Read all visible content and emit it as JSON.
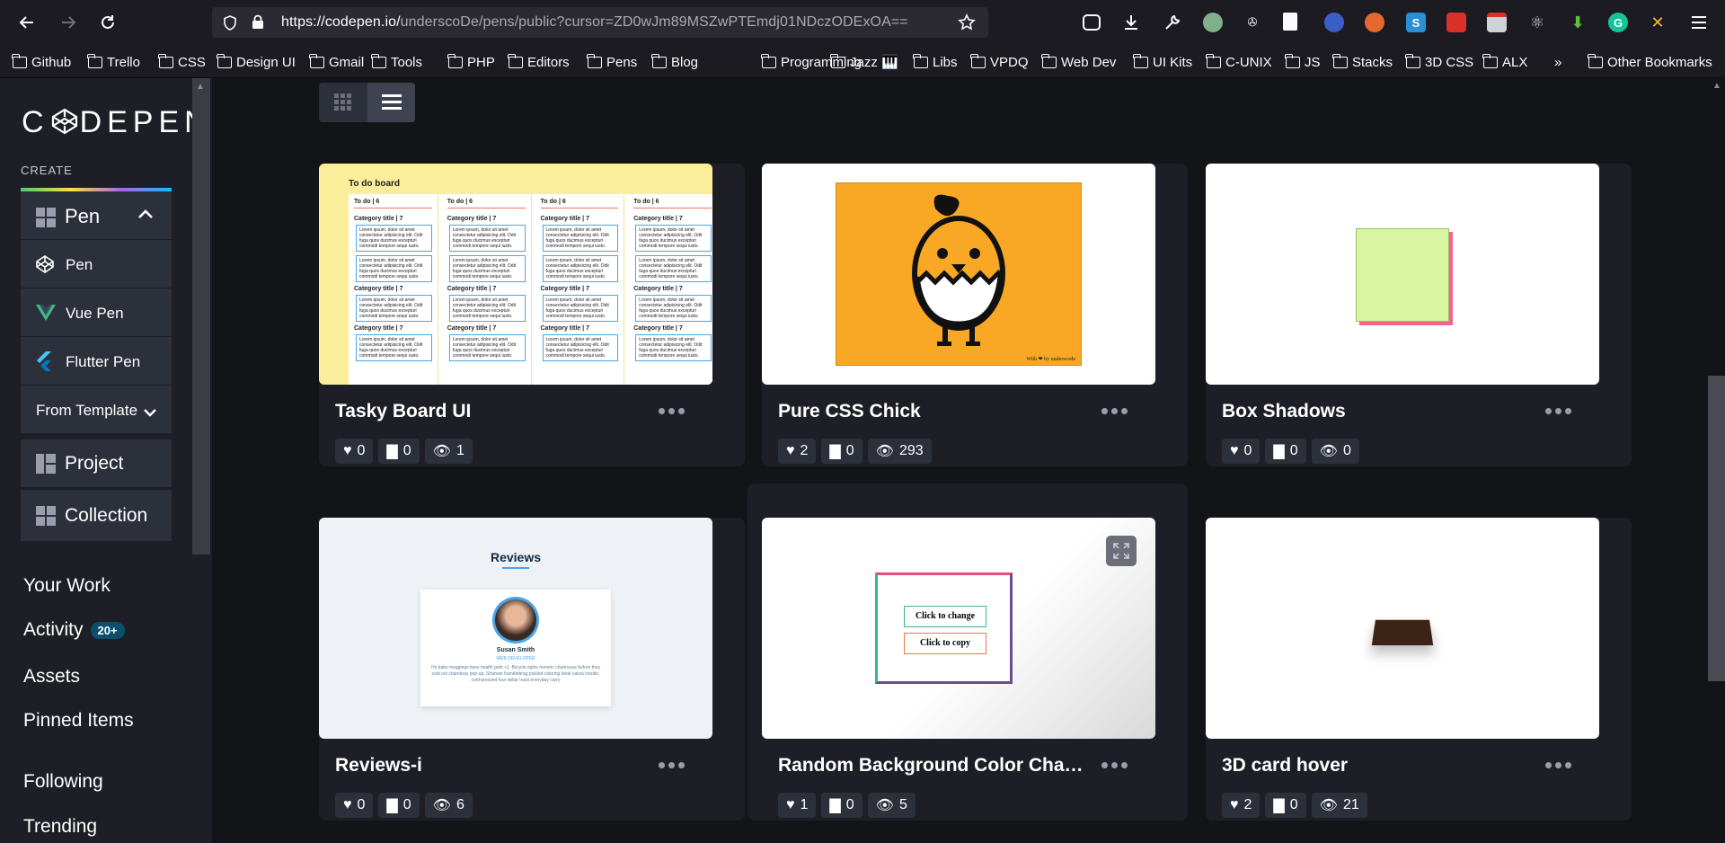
{
  "browser": {
    "url_host": "https://codepen.io/",
    "url_path": "underscoDe/pens/public?cursor=ZD0wJm89MSZwPTEmdj01NDczODExOA==",
    "bookmarks": [
      "Github",
      "Trello",
      "CSS",
      "Design UI",
      "Gmail",
      "Tools",
      "PHP",
      "Editors",
      "Pens",
      "Blog",
      "Programming",
      "Jazz 🎹",
      "Libs",
      "VPDQ",
      "Web Dev",
      "UI Kits",
      "C-UNIX",
      "JS",
      "Stacks",
      "3D CSS",
      "ALX"
    ],
    "other_bookmarks": "Other Bookmarks"
  },
  "sidebar": {
    "logo": "CODEPEN",
    "create_label": "CREATE",
    "pen_header": "Pen",
    "items": [
      {
        "label": "Pen",
        "icon": "codepen-icon"
      },
      {
        "label": "Vue Pen",
        "icon": "vue-icon"
      },
      {
        "label": "Flutter Pen",
        "icon": "flutter-icon"
      }
    ],
    "from_template": "From Template",
    "project": "Project",
    "collection": "Collection",
    "nav": {
      "your_work": "Your Work",
      "activity": "Activity",
      "activity_badge": "20+",
      "assets": "Assets",
      "pinned": "Pinned Items",
      "following": "Following",
      "trending": "Trending"
    }
  },
  "pens": [
    {
      "title": "Tasky Board UI",
      "likes": "0",
      "comments": "0",
      "views": "1"
    },
    {
      "title": "Pure CSS Chick",
      "likes": "2",
      "comments": "0",
      "views": "293"
    },
    {
      "title": "Box Shadows",
      "likes": "0",
      "comments": "0",
      "views": "0"
    },
    {
      "title": "Reviews-i",
      "likes": "0",
      "comments": "0",
      "views": "6"
    },
    {
      "title": "Random Background Color Chan…",
      "likes": "1",
      "comments": "0",
      "views": "5"
    },
    {
      "title": "3D card hover",
      "likes": "2",
      "comments": "0",
      "views": "21"
    }
  ],
  "thumbs": {
    "tasky_heading": "To do board",
    "tasky_col": "To do | 6",
    "tasky_cat": "Category title | 7",
    "tasky_lorem": "Lorem ipsum, dolor sit amet consectetur adipisicing elit. Odit fuga quos ducimus excepturi commodi tempore sequi iusto.",
    "chick_sig": "With ❤ by underscode",
    "reviews_heading": "Reviews",
    "reviews_name": "Susan Smith",
    "reviews_role": "WEB DEVELOPER",
    "reviews_text": "I'm baby meggings twee health goth +1. Bicycle rights tumeric chartreuse before they sold out chambray pop-up. Shaman humblebrag pickled coloring book salvia hoodie, cold-pressed four dollar toast everyday carry",
    "btn_change": "Click to change",
    "btn_copy": "Click to copy"
  }
}
